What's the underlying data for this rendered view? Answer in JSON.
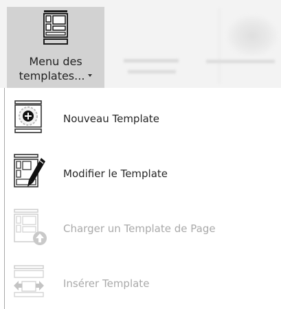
{
  "ribbon": {
    "button": {
      "label_line1": "Menu des",
      "label_line2": "templates...",
      "icon": "template-layout-icon"
    }
  },
  "menu": {
    "items": [
      {
        "label": "Nouveau Template",
        "icon": "new-template-icon",
        "enabled": true
      },
      {
        "label": "Modifier le Template",
        "icon": "edit-template-icon",
        "enabled": true
      },
      {
        "label": "Charger un Template de Page",
        "icon": "load-page-template-icon",
        "enabled": false
      },
      {
        "label": "Insérer Template",
        "icon": "insert-template-icon",
        "enabled": false
      }
    ]
  },
  "colors": {
    "ribbon_bg": "#f3f3f3",
    "button_pressed": "#d2d2d2",
    "text_enabled": "#262626",
    "text_disabled": "#a9a9a9"
  }
}
